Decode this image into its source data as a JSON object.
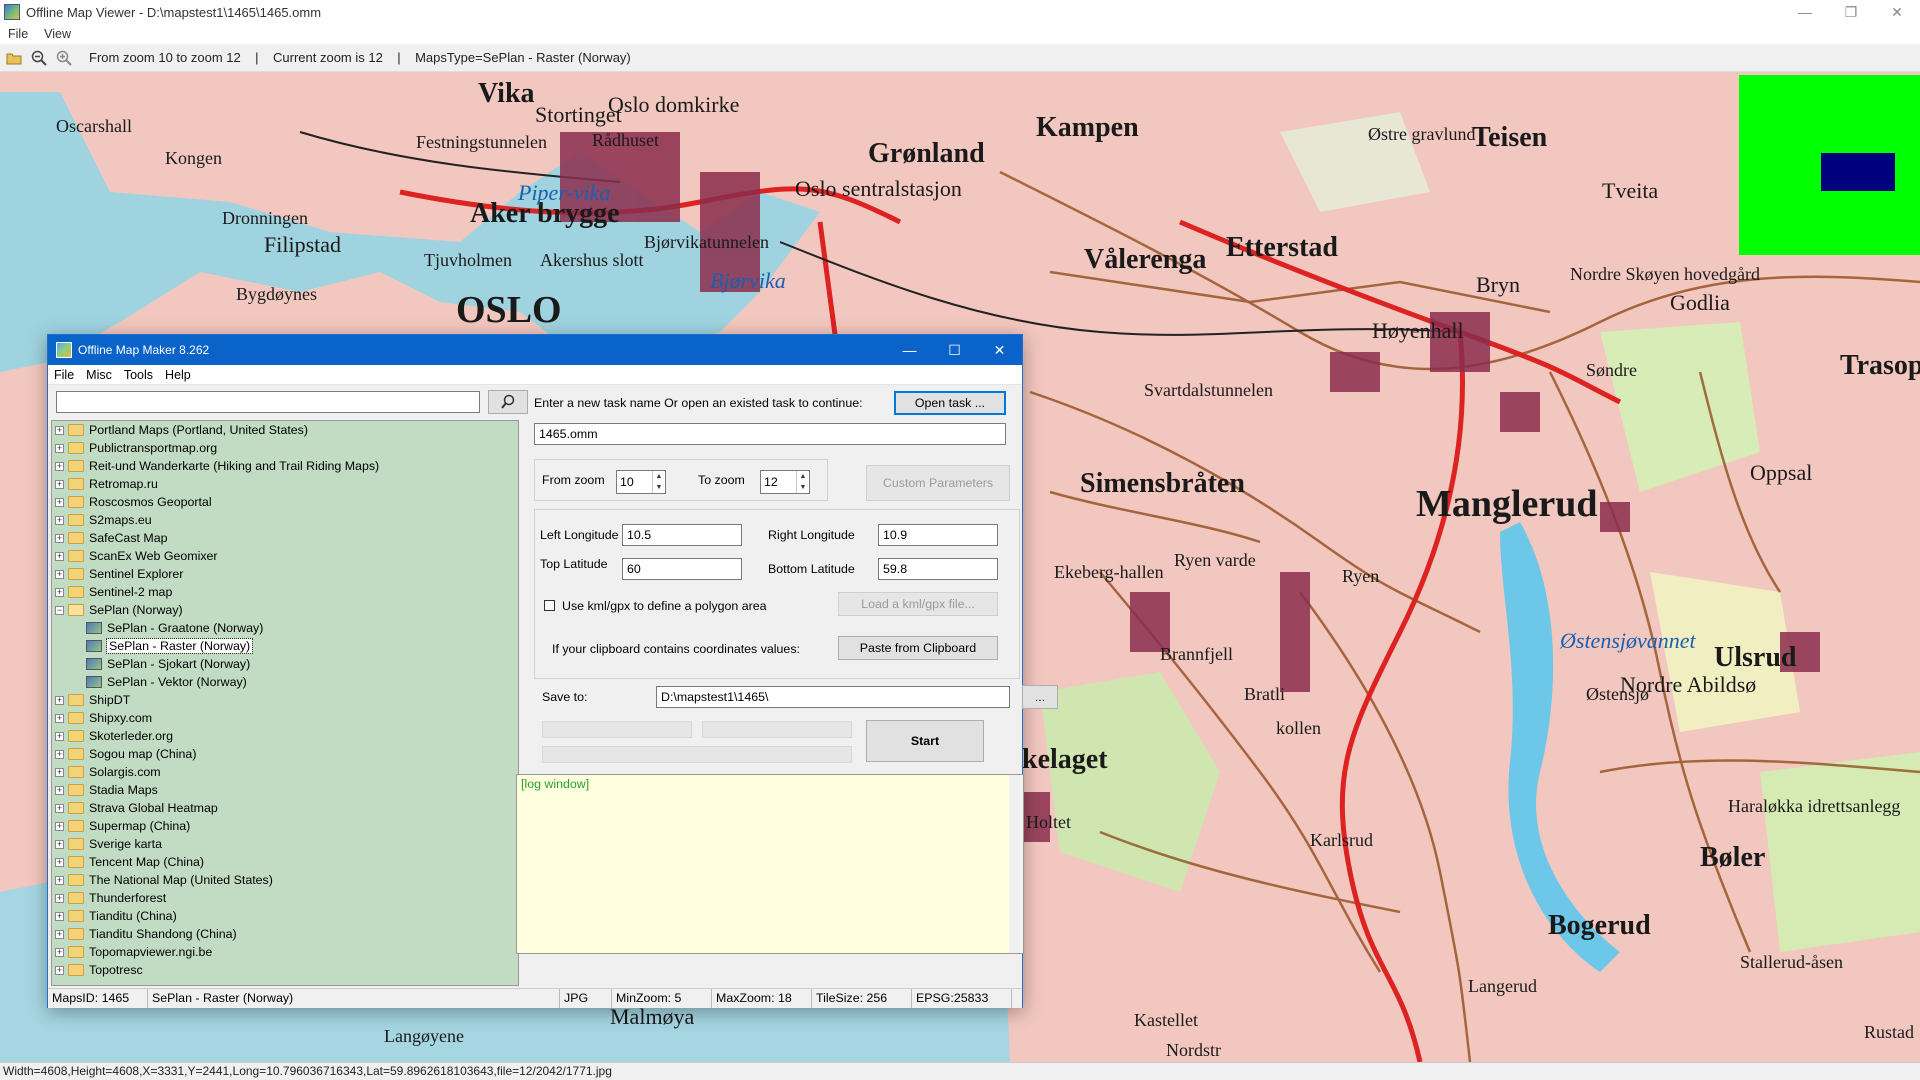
{
  "window": {
    "title": "Offline Map Viewer - D:\\mapstest1\\1465\\1465.omm",
    "controls": [
      "—",
      "❐",
      "✕"
    ]
  },
  "menu": [
    "File",
    "View"
  ],
  "toolbar": {
    "status": "From zoom 10 to zoom 12    |    Current zoom is 12    |    MapsType=SePlan - Raster (Norway)"
  },
  "map_labels": [
    "Vika",
    "Oslo domkirke",
    "Stortinget",
    "Oscarshall",
    "Kongen",
    "Festningstunnelen",
    "Rådhuset",
    "Grønland",
    "Kampen",
    "Østre gravlund",
    "Teisen",
    "Oslo sentralstasjon",
    "Aker brygge",
    "Piper-vika",
    "Dronningen",
    "Filipstad",
    "Bjørvikatunnelen",
    "Tjuvholmen",
    "Akershus slott",
    "Tveita",
    "Vålerenga",
    "Etterstad",
    "Bygdøynes",
    "OSLO",
    "Bjørvika",
    "Nordre Skøyen hovedgård",
    "Godlia",
    "Bryn",
    "Høyenhall",
    "Trasopp",
    "Svartdalstunnelen",
    "Søndre",
    "Oppsal",
    "Simensbråten",
    "Manglerud",
    "Ekeberg-hallen",
    "Ryen varde",
    "Ryen",
    "Brannfjell",
    "Østensjøvannet",
    "Nordre Abildsø",
    "Ulsrud",
    "Østensjø",
    "Bratli",
    "kollen",
    "Karlsrud",
    "Haraløkka idrettsanlegg",
    "Bøler",
    "Bogerud",
    "Langerud",
    "Stallerud-åsen",
    "Malmøya",
    "Langøyene",
    "Kastellet",
    "Nordstr",
    "Rustad",
    "Holtet",
    "kelaget"
  ],
  "overview": {
    "color": "#00ff00",
    "viewport_color": "#00007f"
  },
  "statusbar": "Width=4608,Height=4608,X=3331,Y=2441,Long=10.796036716343,Lat=59.8962618103643,file=12/2042/1771.jpg",
  "dialog": {
    "title": "Offline Map Maker 8.262",
    "menu": [
      "File",
      "Misc",
      "Tools",
      "Help"
    ],
    "search_placeholder": "",
    "tree": [
      {
        "label": "Portland Maps (Portland, United States)",
        "type": "folder"
      },
      {
        "label": "Publictransportmap.org",
        "type": "folder"
      },
      {
        "label": "Reit-und Wanderkarte (Hiking and Trail Riding Maps)",
        "type": "folder"
      },
      {
        "label": "Retromap.ru",
        "type": "folder"
      },
      {
        "label": "Roscosmos Geoportal",
        "type": "folder"
      },
      {
        "label": "S2maps.eu",
        "type": "folder"
      },
      {
        "label": "SafeCast Map",
        "type": "folder"
      },
      {
        "label": "ScanEx Web Geomixer",
        "type": "folder"
      },
      {
        "label": "Sentinel Explorer",
        "type": "folder"
      },
      {
        "label": "Sentinel-2 map",
        "type": "folder"
      },
      {
        "label": "SePlan (Norway)",
        "type": "folder-open"
      },
      {
        "label": "SePlan - Graatone (Norway)",
        "type": "child"
      },
      {
        "label": "SePlan - Raster (Norway)",
        "type": "child-selected"
      },
      {
        "label": "SePlan - Sjokart (Norway)",
        "type": "child"
      },
      {
        "label": "SePlan - Vektor (Norway)",
        "type": "child"
      },
      {
        "label": "ShipDT",
        "type": "folder"
      },
      {
        "label": "Shipxy.com",
        "type": "folder"
      },
      {
        "label": "Skoterleder.org",
        "type": "folder"
      },
      {
        "label": "Sogou map (China)",
        "type": "folder"
      },
      {
        "label": "Solargis.com",
        "type": "folder"
      },
      {
        "label": "Stadia Maps",
        "type": "folder"
      },
      {
        "label": "Strava Global Heatmap",
        "type": "folder"
      },
      {
        "label": "Supermap (China)",
        "type": "folder"
      },
      {
        "label": "Sverige karta",
        "type": "folder"
      },
      {
        "label": "Tencent Map (China)",
        "type": "folder"
      },
      {
        "label": "The National Map (United States)",
        "type": "folder"
      },
      {
        "label": "Thunderforest",
        "type": "folder"
      },
      {
        "label": "Tianditu (China)",
        "type": "folder"
      },
      {
        "label": "Tianditu Shandong (China)",
        "type": "folder"
      },
      {
        "label": "Topomapviewer.ngi.be",
        "type": "folder"
      },
      {
        "label": "Topotresc",
        "type": "folder"
      }
    ],
    "task_prompt": "Enter a new task name Or open an existed task to continue:",
    "open_task_label": "Open task ...",
    "task_name": "1465.omm",
    "from_zoom_label": "From zoom",
    "from_zoom": "10",
    "to_zoom_label": "To zoom",
    "to_zoom": "12",
    "custom_params_label": "Custom Parameters",
    "left_lon_label": "Left Longitude",
    "left_lon": "10.5",
    "right_lon_label": "Right Longitude",
    "right_lon": "10.9",
    "top_lat_label": "Top Latitude",
    "top_lat": "60",
    "bottom_lat_label": "Bottom Latitude",
    "bottom_lat": "59.8",
    "kml_label": "Use kml/gpx to define a polygon area",
    "load_kml_label": "Load a kml/gpx file...",
    "clipboard_prompt": "If your clipboard contains coordinates values:",
    "paste_label": "Paste from Clipboard",
    "save_to_label": "Save to:",
    "save_to": "D:\\mapstest1\\1465\\",
    "browse_label": "...",
    "start_label": "Start",
    "log_text": "[log window]",
    "status": {
      "maps_id": "MapsID: 1465",
      "map_name": "SePlan - Raster (Norway)",
      "format": "JPG",
      "min_zoom": "MinZoom: 5",
      "max_zoom": "MaxZoom: 18",
      "tile_size": "TileSize: 256",
      "epsg": "EPSG:25833"
    }
  }
}
